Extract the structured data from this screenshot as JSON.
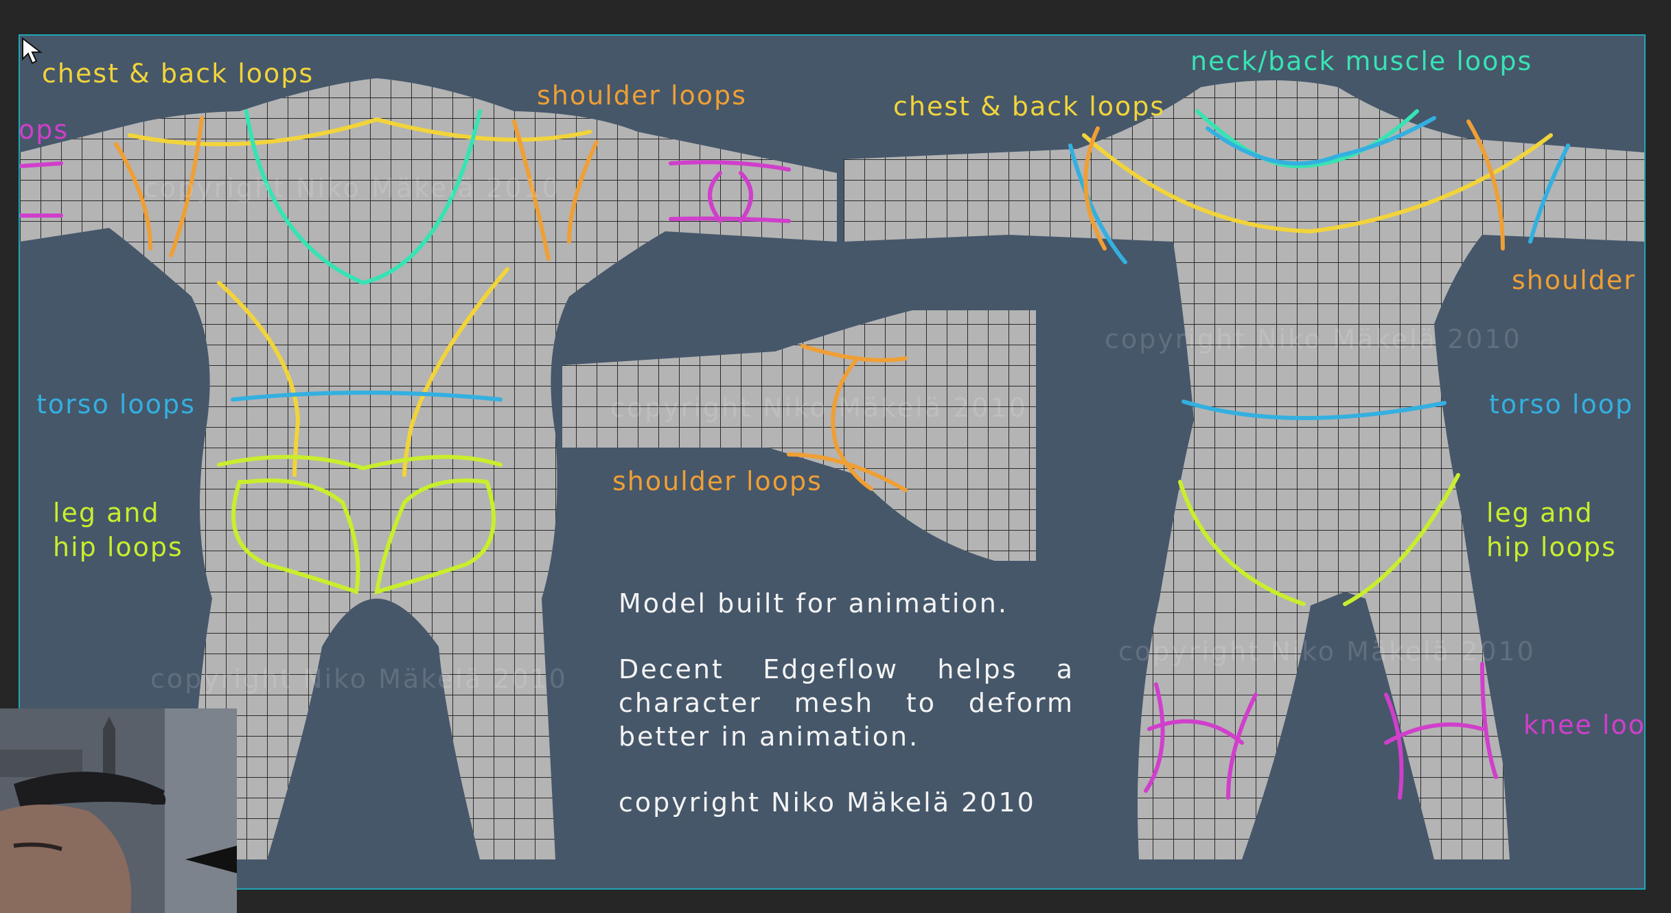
{
  "labels": {
    "chest_back_left": "chest & back loops",
    "shoulder_top": "shoulder loops",
    "knee_cut_left": "ops",
    "torso_left": "torso loops",
    "leg_hip_left_1": "leg and",
    "leg_hip_left_2": "hip loops",
    "neck_back": "neck/back muscle loops",
    "chest_back_right": "chest & back loops",
    "shoulder_right_cut": "shoulder",
    "torso_right_cut": "torso loop",
    "leg_hip_right_1": "leg and",
    "leg_hip_right_2": "hip loops",
    "knee_right_cut": "knee loo",
    "shoulder_center": "shoulder loops"
  },
  "description": {
    "line1": "Model built for animation.",
    "line2": "Decent Edgeflow helps a character mesh to deform better in animation.",
    "line3": "copyright Niko Mäkelä 2010"
  },
  "watermark": "copyright Niko Mäkelä 2010",
  "colors": {
    "frame_border": "#1fa6b8",
    "background": "#46576a",
    "mesh": "#b4b4b4",
    "yellow": "#f2d43a",
    "orange": "#ef9f35",
    "teal": "#37e3b3",
    "blue": "#33b0e0",
    "lime": "#c8ee2d",
    "magenta": "#d03fcb"
  }
}
